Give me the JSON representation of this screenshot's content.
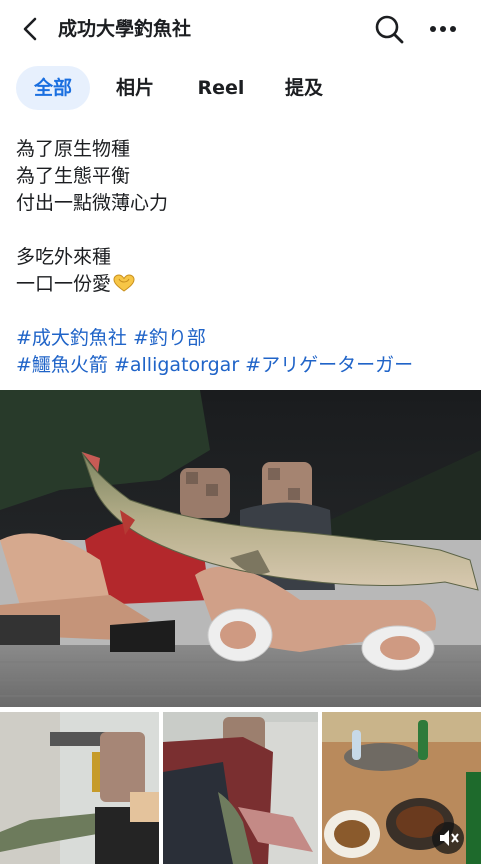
{
  "header": {
    "title": "成功大學釣魚社"
  },
  "tabs": [
    {
      "label": "全部",
      "active": true
    },
    {
      "label": "相片",
      "active": false
    },
    {
      "label": "Reel",
      "active": false
    },
    {
      "label": "提及",
      "active": false
    }
  ],
  "post": {
    "lines": [
      "為了原生物種",
      "為了生態平衡",
      "付出一點微薄心力",
      "多吃外來種",
      "一口一份愛"
    ],
    "hashtag_lines": [
      "#成大釣魚社 #釣り部",
      "#鱷魚火箭 #alligatorgar #アリゲーターガー"
    ]
  },
  "colors": {
    "accent": "#1a6fe0",
    "accent_bg": "#e7f0fd",
    "hashtag": "#2064c8"
  },
  "icons": [
    "back-arrow-icon",
    "search-icon",
    "more-icon",
    "heart-hands-emoji",
    "mute-icon"
  ]
}
